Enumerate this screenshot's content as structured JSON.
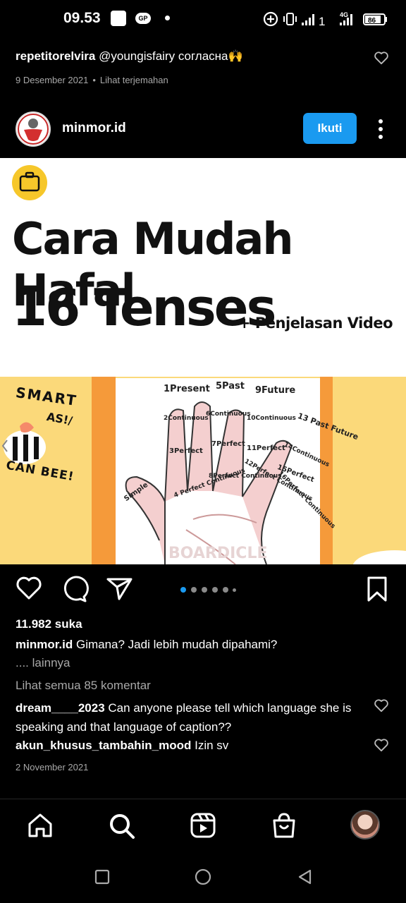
{
  "status_bar": {
    "time": "09.53",
    "badge": "GP",
    "network": "4G",
    "signal_extra": "1",
    "battery": "86"
  },
  "previous_comment": {
    "user": "repetitorelvira",
    "text": "@youngisfairy согласна🙌",
    "date": "9 Desember 2021",
    "translate": "Lihat terjemahan"
  },
  "post": {
    "username": "minmor.id",
    "follow_label": "Ikuti",
    "image": {
      "title_line1": "Cara Mudah Hafal",
      "title_line2": "16 Tenses",
      "subtitle": "+ Penjelasan Video",
      "sticker_smart": "SMART",
      "sticker_as": "AS!/",
      "sticker_canbee": "CAN BEE!",
      "watermark": "BOARDICLE",
      "hand_labels": [
        "1Present",
        "5Past",
        "9Future",
        "2Continuous",
        "6Continuous",
        "10Continuous",
        "13 Past Future",
        "3Perfect",
        "7Perfect",
        "11Perfect",
        "14Continuous",
        "15Perfect",
        "4 Perfect Continuous",
        "8Perfect Continuous",
        "12Perfect Continuous",
        "16Perfect Continuous",
        "Simple"
      ]
    },
    "carousel": {
      "count": 6,
      "active_index": 0
    },
    "likes": "11.982 suka",
    "caption_user": "minmor.id",
    "caption_text": "Gimana? Jadi lebih mudah dipahami?",
    "caption_more": ".... lainnya",
    "view_all_comments": "Lihat semua 85 komentar",
    "comments": [
      {
        "user": "dream____2023",
        "text": "Can anyone please tell which language she is speaking and that language of caption??"
      },
      {
        "user": "akun_khusus_tambahin_mood",
        "text": "Izin sv"
      }
    ],
    "date": "2 November 2021"
  },
  "colors": {
    "background": "#000000",
    "follow_button": "#1a9af0",
    "carousel_active": "#1a9af0",
    "muted_text": "#a8a8a8"
  },
  "bottom_nav": [
    "home-icon",
    "search-icon",
    "reels-icon",
    "shop-icon",
    "profile-avatar"
  ],
  "system_nav": [
    "recents-icon",
    "home-circle-icon",
    "back-icon"
  ]
}
